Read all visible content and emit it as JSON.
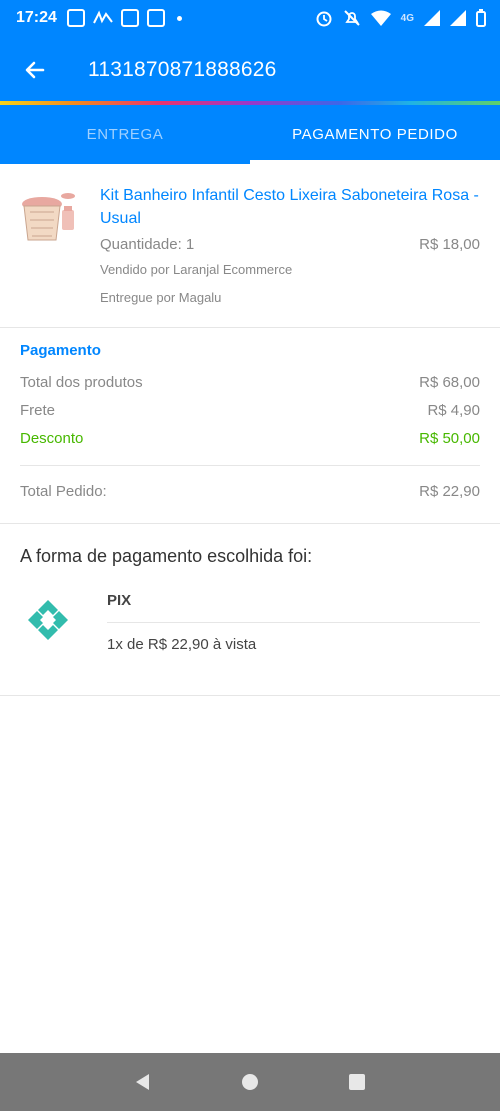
{
  "status_bar": {
    "time": "17:24",
    "network": "4G"
  },
  "app_bar": {
    "order_id": "1131870871888626"
  },
  "tabs": [
    {
      "label": "ENTREGA",
      "active": false
    },
    {
      "label": "PAGAMENTO PEDIDO",
      "active": true
    }
  ],
  "product": {
    "title": "Kit Banheiro Infantil Cesto Lixeira Saboneteira Rosa - Usual",
    "quantity": "Quantidade: 1",
    "price": "R$ 18,00",
    "seller": "Vendido por Laranjal Ecommerce",
    "delivered_by": "Entregue por Magalu"
  },
  "payment": {
    "title": "Pagamento",
    "rows": [
      {
        "label": "Total dos produtos",
        "value": "R$ 68,00"
      },
      {
        "label": "Frete",
        "value": "R$ 4,90"
      },
      {
        "label": "Desconto",
        "value": "R$ 50,00"
      }
    ],
    "total_label": "Total Pedido:",
    "total_value": "R$ 22,90"
  },
  "method": {
    "heading": "A forma de pagamento escolhida foi:",
    "name": "PIX",
    "installments": "1x de R$ 22,90 à vista"
  },
  "colors": {
    "primary": "#0086ff",
    "discount": "#47b800",
    "pix": "#32bcad",
    "navbar": "#777777"
  },
  "icons": [
    "back-arrow-icon",
    "pix-icon",
    "nav-back-icon",
    "nav-home-icon",
    "nav-recents-icon",
    "alarm-icon",
    "mute-icon",
    "wifi-icon",
    "signal-icon",
    "battery-icon"
  ]
}
